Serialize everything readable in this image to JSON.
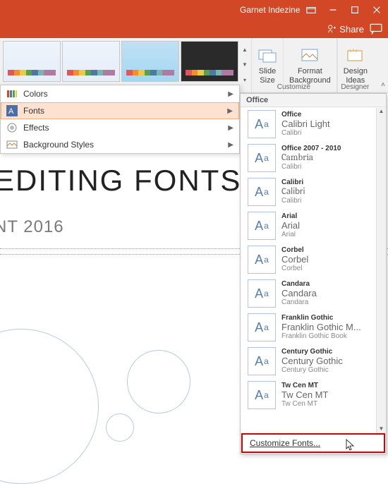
{
  "titlebar": {
    "user": "Garnet Indezine"
  },
  "sharebar": {
    "share": "Share"
  },
  "ribbon": {
    "slideSize": "Slide\nSize",
    "formatBg": "Format\nBackground",
    "designIdeas": "Design\nIdeas",
    "customize": "Customize",
    "designer": "Designer"
  },
  "dropdown": {
    "colors": "Colors",
    "fonts": "Fonts",
    "effects": "Effects",
    "bgstyles": "Background Styles"
  },
  "fontpanel": {
    "header": "Office",
    "items": [
      {
        "name": "Office",
        "heading": "Calibri Light",
        "body": "Calibri"
      },
      {
        "name": "Office 2007 - 2010",
        "heading": "Cambria",
        "body": "Calibri"
      },
      {
        "name": "Calibri",
        "heading": "Calibri",
        "body": "Calibri"
      },
      {
        "name": "Arial",
        "heading": "Arial",
        "body": "Arial"
      },
      {
        "name": "Corbel",
        "heading": "Corbel",
        "body": "Corbel"
      },
      {
        "name": "Candara",
        "heading": "Candara",
        "body": "Candara"
      },
      {
        "name": "Franklin Gothic",
        "heading": "Franklin Gothic M...",
        "body": "Franklin Gothic Book"
      },
      {
        "name": "Century Gothic",
        "heading": "Century Gothic",
        "body": "Century Gothic"
      },
      {
        "name": "Tw Cen MT",
        "heading": "Tw Cen MT",
        "body": "Tw Cen MT"
      }
    ],
    "customize": "Customize Fonts..."
  },
  "slide": {
    "title": "EDITING FONTS",
    "subtitle": "NT 2016"
  }
}
